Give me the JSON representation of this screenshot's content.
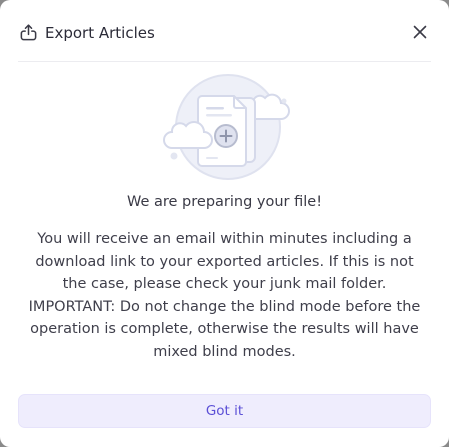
{
  "dialog": {
    "title": "Export Articles",
    "headline": "We are preparing your file!",
    "message": "You will receive an email within minutes including a download link to your exported articles. If this is not the case, please check your junk mail folder. IMPORTANT: Do not change the blind mode before the operation is complete, otherwise the results will have mixed blind modes.",
    "confirm_label": "Got it"
  },
  "icons": {
    "header": "export-icon",
    "close": "close-icon",
    "illustration": "file-preparing-illustration"
  },
  "colors": {
    "accent": "#5b4fd6",
    "button_bg": "#efedfd",
    "title_text": "#2b2b38",
    "body_text": "#3f3f4b",
    "illustration_circle": "#eef0f8"
  }
}
